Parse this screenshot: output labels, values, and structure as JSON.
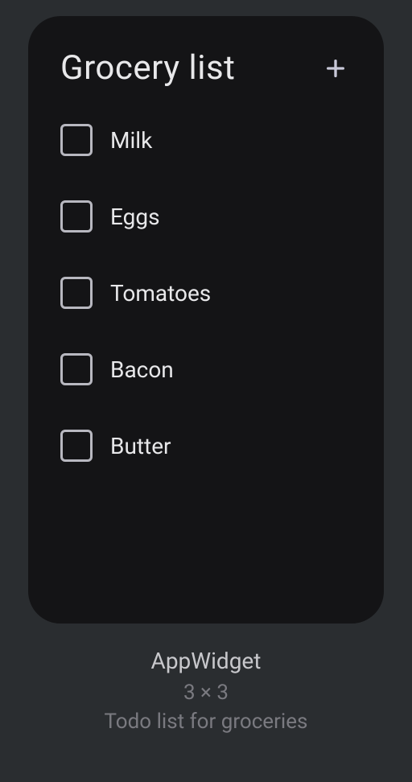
{
  "widget": {
    "title": "Grocery list",
    "items": [
      {
        "label": "Milk"
      },
      {
        "label": "Eggs"
      },
      {
        "label": "Tomatoes"
      },
      {
        "label": "Bacon"
      },
      {
        "label": "Butter"
      }
    ]
  },
  "info": {
    "name": "AppWidget",
    "size": "3 × 3",
    "description": "Todo list for groceries"
  }
}
